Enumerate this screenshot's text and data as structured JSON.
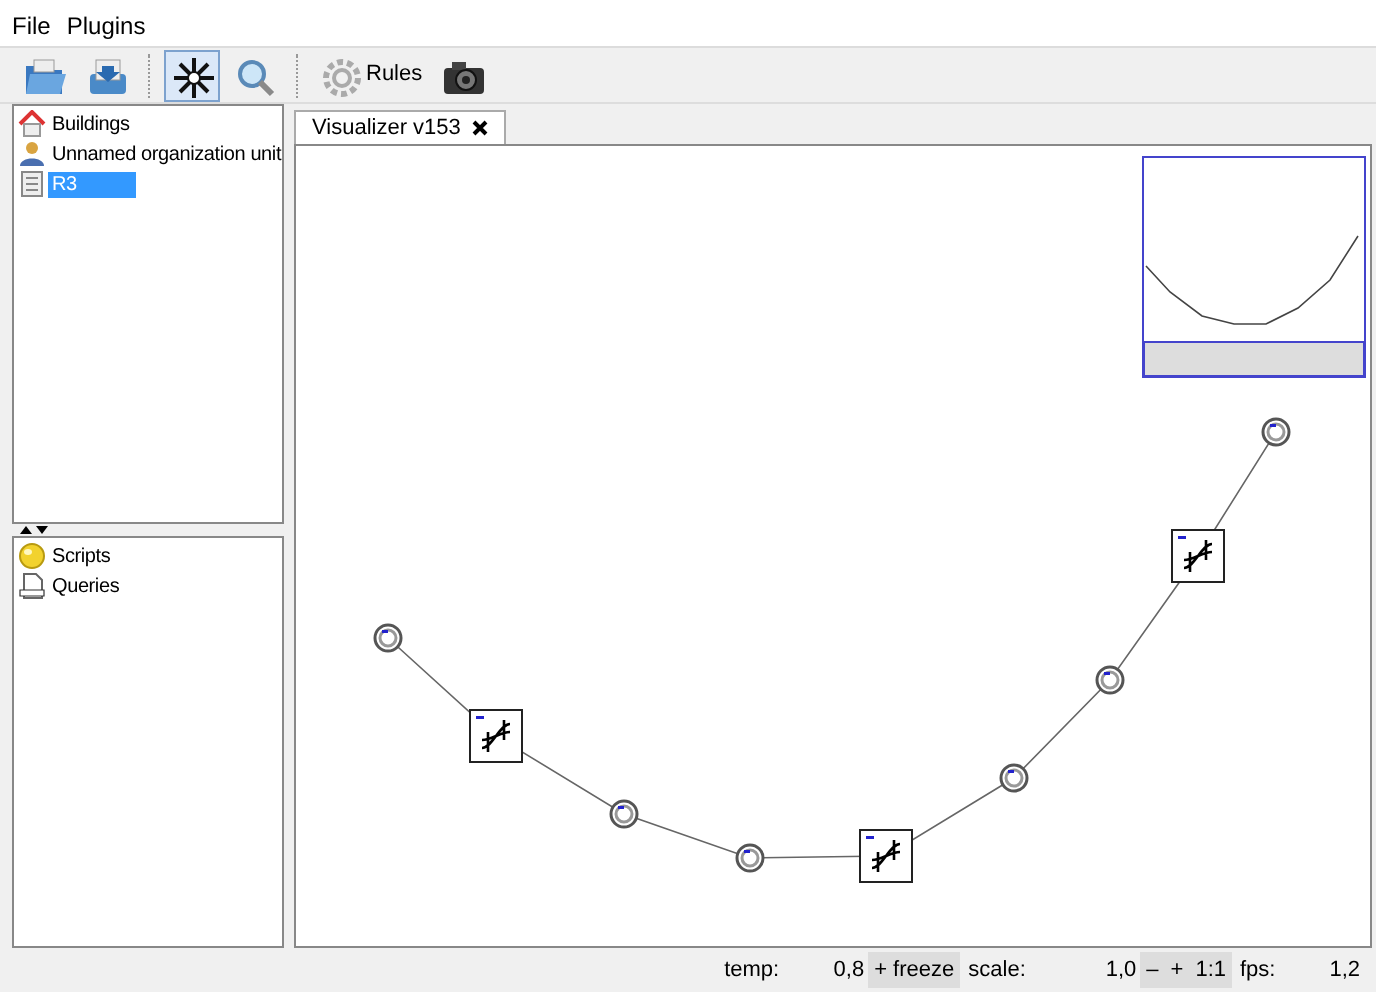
{
  "menu": [
    "File",
    "Plugins"
  ],
  "toolbar": [
    {
      "selected": false
    },
    {
      "selected": false
    },
    {
      "selected": true
    },
    {
      "selected": false
    },
    {
      "label": "Rules",
      "selected": false
    },
    {
      "selected": false
    }
  ],
  "tree": [
    {
      "label": "Buildings",
      "selected": false
    },
    {
      "label": "Unnamed organization unit",
      "selected": false
    },
    {
      "label": "R3",
      "selected": true
    }
  ],
  "lower_tree": [
    {
      "label": "Scripts",
      "selected": false
    },
    {
      "label": "Queries",
      "selected": false
    }
  ],
  "tabs": [
    {
      "label": "Visualizer v153",
      "selected": true
    }
  ],
  "graph": {
    "nodes": [
      {
        "kind": "vertex"
      },
      {
        "kind": "switch"
      },
      {
        "kind": "vertex"
      },
      {
        "kind": "vertex"
      },
      {
        "kind": "switch"
      },
      {
        "kind": "vertex"
      },
      {
        "kind": "vertex"
      },
      {
        "kind": "switch"
      },
      {
        "kind": "vertex"
      }
    ]
  },
  "status_bar": {
    "temp_label": "temp:",
    "temp": "0,8",
    "freeze": "+ freeze",
    "scale_label": "scale:",
    "scale": "1,0",
    "scale_buttons": [
      "–",
      "+",
      "1:1"
    ],
    "fps_label": "fps:",
    "fps": "1,2"
  }
}
